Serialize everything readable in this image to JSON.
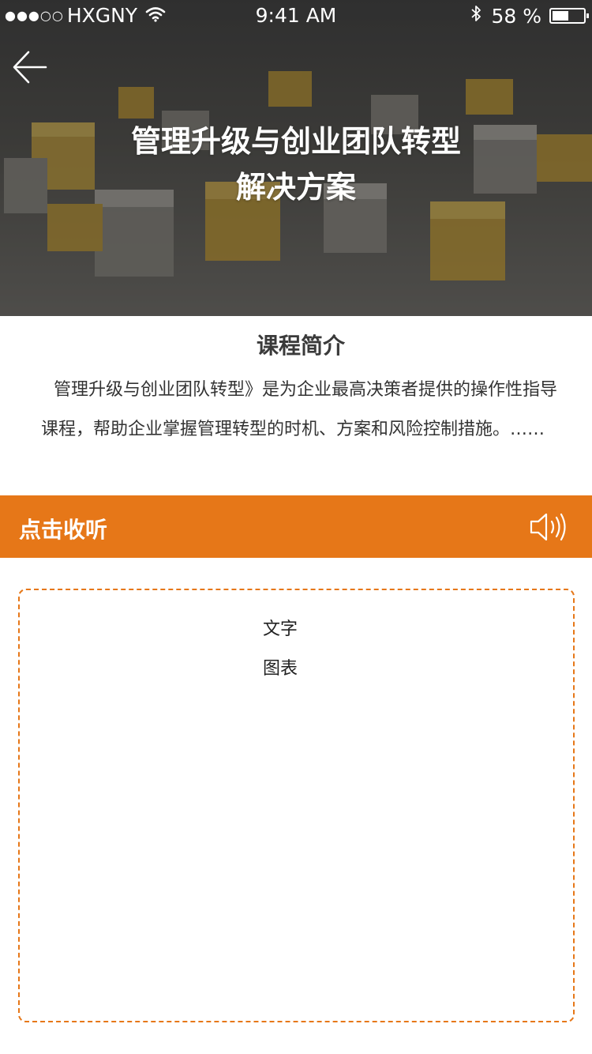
{
  "status_bar": {
    "signal": "●●●○○",
    "carrier": "HXGNY",
    "time": "9:41 AM",
    "battery_text": "58 %",
    "battery_level": 0.58
  },
  "hero": {
    "title_line1": "管理升级与创业团队转型",
    "title_line2": "解决方案"
  },
  "intro": {
    "heading": "课程简介",
    "body": "管理升级与创业团队转型》是为企业最高决策者提供的操作性指导课程，帮助企业掌握管理转型的时机、方案和风险控制措施。……"
  },
  "listen": {
    "label": "点击收听"
  },
  "content": {
    "line1": "文字",
    "line2": "图表"
  },
  "colors": {
    "accent": "#e67718"
  }
}
